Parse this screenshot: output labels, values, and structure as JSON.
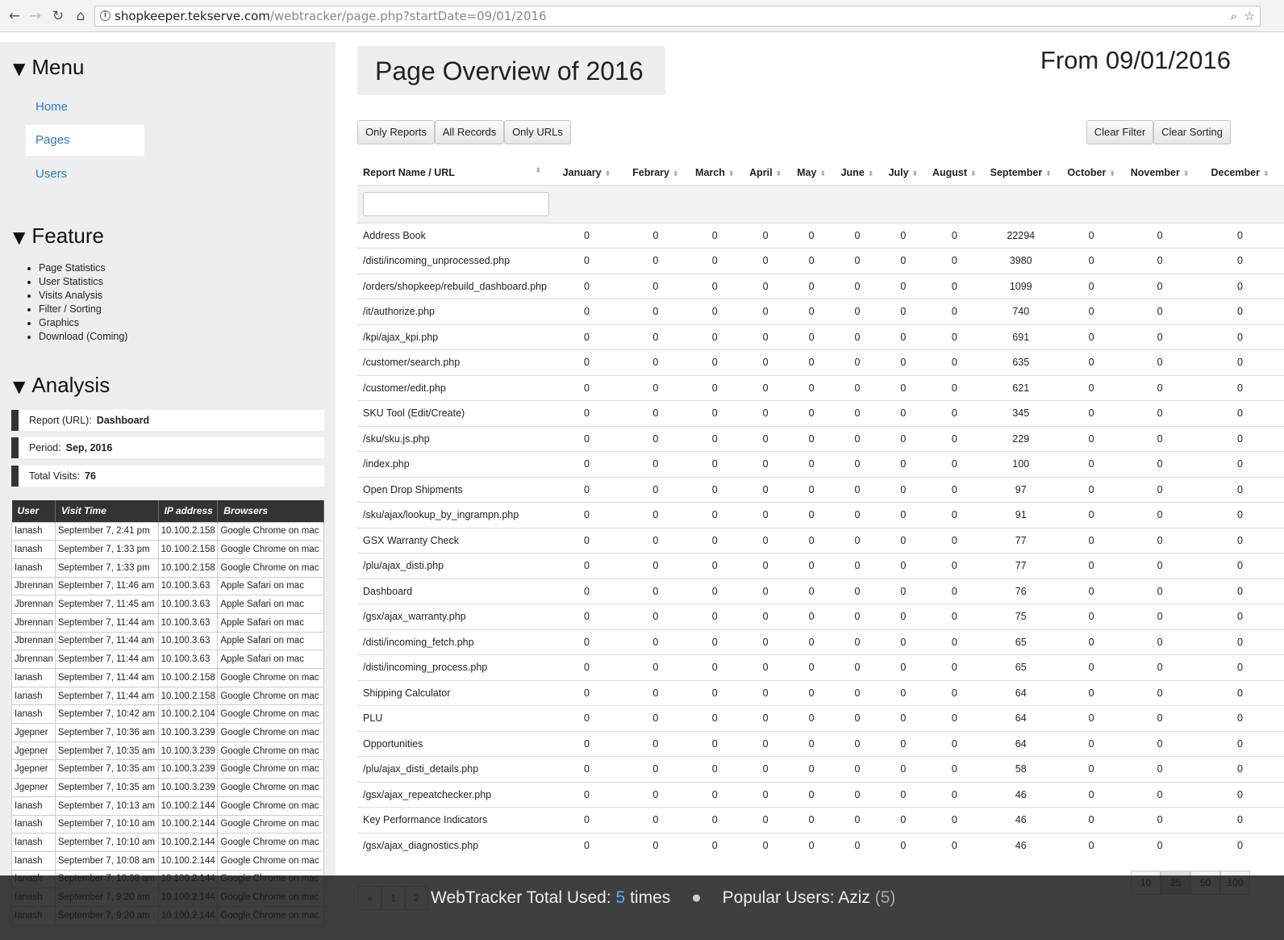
{
  "browser": {
    "url_host": "shopkeeper.tekserve.com",
    "url_path": "/webtracker/page.php?startDate=09/01/2016"
  },
  "sidebar": {
    "menu_heading": "Menu",
    "menu_items": [
      {
        "label": "Home"
      },
      {
        "label": "Pages",
        "active": true
      },
      {
        "label": "Users"
      }
    ],
    "feature_heading": "Feature",
    "features": [
      "Page Statistics",
      "User Statistics",
      "Visits Analysis",
      "Filter / Sorting",
      "Graphics",
      "Download (Coming)"
    ],
    "analysis_heading": "Analysis",
    "stats": [
      {
        "label": "Report (URL):",
        "value": "Dashboard"
      },
      {
        "label": "Period:",
        "value": "Sep, 2016"
      },
      {
        "label": "Total Visits:",
        "value": "76"
      }
    ],
    "visits_columns": [
      "User",
      "Visit Time",
      "IP address",
      "Browsers"
    ],
    "visits": [
      [
        "Ianash",
        "September 7, 2:41 pm",
        "10.100.2.158",
        "Google Chrome on mac"
      ],
      [
        "Ianash",
        "September 7, 1:33 pm",
        "10.100.2.158",
        "Google Chrome on mac"
      ],
      [
        "Ianash",
        "September 7, 1:33 pm",
        "10.100.2.158",
        "Google Chrome on mac"
      ],
      [
        "Jbrennan",
        "September 7, 11:46 am",
        "10.100.3.63",
        "Apple Safari on mac"
      ],
      [
        "Jbrennan",
        "September 7, 11:45 am",
        "10.100.3.63",
        "Apple Safari on mac"
      ],
      [
        "Jbrennan",
        "September 7, 11:44 am",
        "10.100.3.63",
        "Apple Safari on mac"
      ],
      [
        "Jbrennan",
        "September 7, 11:44 am",
        "10.100.3.63",
        "Apple Safari on mac"
      ],
      [
        "Jbrennan",
        "September 7, 11:44 am",
        "10.100.3.63",
        "Apple Safari on mac"
      ],
      [
        "Ianash",
        "September 7, 11:44 am",
        "10.100.2.158",
        "Google Chrome on mac"
      ],
      [
        "Ianash",
        "September 7, 11:44 am",
        "10.100.2.158",
        "Google Chrome on mac"
      ],
      [
        "Ianash",
        "September 7, 10:42 am",
        "10.100.2.104",
        "Google Chrome on mac"
      ],
      [
        "Jgepner",
        "September 7, 10:36 am",
        "10.100.3.239",
        "Google Chrome on mac"
      ],
      [
        "Jgepner",
        "September 7, 10:35 am",
        "10.100.3.239",
        "Google Chrome on mac"
      ],
      [
        "Jgepner",
        "September 7, 10:35 am",
        "10.100.3.239",
        "Google Chrome on mac"
      ],
      [
        "Jgepner",
        "September 7, 10:35 am",
        "10.100.3.239",
        "Google Chrome on mac"
      ],
      [
        "Ianash",
        "September 7, 10:13 am",
        "10.100.2.144",
        "Google Chrome on mac"
      ],
      [
        "Ianash",
        "September 7, 10:10 am",
        "10.100.2.144",
        "Google Chrome on mac"
      ],
      [
        "Ianash",
        "September 7, 10:10 am",
        "10.100.2.144",
        "Google Chrome on mac"
      ],
      [
        "Ianash",
        "September 7, 10:08 am",
        "10.100.2.144",
        "Google Chrome on mac"
      ],
      [
        "Ianash",
        "September 7, 10:08 am",
        "10.100.2.144",
        "Google Chrome on mac"
      ],
      [
        "Ianash",
        "September 7, 9:20 am",
        "10.100.2.144",
        "Google Chrome on mac"
      ],
      [
        "Ianash",
        "September 7, 9:20 am",
        "10.100.2.144",
        "Google Chrome on mac"
      ]
    ]
  },
  "main": {
    "title": "Page Overview of 2016",
    "from_date": "From 09/01/2016",
    "buttons": {
      "only_reports": "Only Reports",
      "all_records": "All Records",
      "only_urls": "Only URLs",
      "clear_filter": "Clear Filter",
      "clear_sorting": "Clear Sorting"
    },
    "columns": [
      "Report Name / URL",
      "January",
      "Febrary",
      "March",
      "April",
      "May",
      "June",
      "July",
      "August",
      "September",
      "October",
      "November",
      "December"
    ],
    "rows": [
      [
        "Address Book",
        "0",
        "0",
        "0",
        "0",
        "0",
        "0",
        "0",
        "0",
        "22294",
        "0",
        "0",
        "0"
      ],
      [
        "/disti/incoming_unprocessed.php",
        "0",
        "0",
        "0",
        "0",
        "0",
        "0",
        "0",
        "0",
        "3980",
        "0",
        "0",
        "0"
      ],
      [
        "/orders/shopkeep/rebuild_dashboard.php",
        "0",
        "0",
        "0",
        "0",
        "0",
        "0",
        "0",
        "0",
        "1099",
        "0",
        "0",
        "0"
      ],
      [
        "/it/authorize.php",
        "0",
        "0",
        "0",
        "0",
        "0",
        "0",
        "0",
        "0",
        "740",
        "0",
        "0",
        "0"
      ],
      [
        "/kpi/ajax_kpi.php",
        "0",
        "0",
        "0",
        "0",
        "0",
        "0",
        "0",
        "0",
        "691",
        "0",
        "0",
        "0"
      ],
      [
        "/customer/search.php",
        "0",
        "0",
        "0",
        "0",
        "0",
        "0",
        "0",
        "0",
        "635",
        "0",
        "0",
        "0"
      ],
      [
        "/customer/edit.php",
        "0",
        "0",
        "0",
        "0",
        "0",
        "0",
        "0",
        "0",
        "621",
        "0",
        "0",
        "0"
      ],
      [
        "SKU Tool (Edit/Create)",
        "0",
        "0",
        "0",
        "0",
        "0",
        "0",
        "0",
        "0",
        "345",
        "0",
        "0",
        "0"
      ],
      [
        "/sku/sku.js.php",
        "0",
        "0",
        "0",
        "0",
        "0",
        "0",
        "0",
        "0",
        "229",
        "0",
        "0",
        "0"
      ],
      [
        "/index.php",
        "0",
        "0",
        "0",
        "0",
        "0",
        "0",
        "0",
        "0",
        "100",
        "0",
        "0",
        "0"
      ],
      [
        "Open Drop Shipments",
        "0",
        "0",
        "0",
        "0",
        "0",
        "0",
        "0",
        "0",
        "97",
        "0",
        "0",
        "0"
      ],
      [
        "/sku/ajax/lookup_by_ingrampn.php",
        "0",
        "0",
        "0",
        "0",
        "0",
        "0",
        "0",
        "0",
        "91",
        "0",
        "0",
        "0"
      ],
      [
        "GSX Warranty Check",
        "0",
        "0",
        "0",
        "0",
        "0",
        "0",
        "0",
        "0",
        "77",
        "0",
        "0",
        "0"
      ],
      [
        "/plu/ajax_disti.php",
        "0",
        "0",
        "0",
        "0",
        "0",
        "0",
        "0",
        "0",
        "77",
        "0",
        "0",
        "0"
      ],
      [
        "Dashboard",
        "0",
        "0",
        "0",
        "0",
        "0",
        "0",
        "0",
        "0",
        "76",
        "0",
        "0",
        "0"
      ],
      [
        "/gsx/ajax_warranty.php",
        "0",
        "0",
        "0",
        "0",
        "0",
        "0",
        "0",
        "0",
        "75",
        "0",
        "0",
        "0"
      ],
      [
        "/disti/incoming_fetch.php",
        "0",
        "0",
        "0",
        "0",
        "0",
        "0",
        "0",
        "0",
        "65",
        "0",
        "0",
        "0"
      ],
      [
        "/disti/incoming_process.php",
        "0",
        "0",
        "0",
        "0",
        "0",
        "0",
        "0",
        "0",
        "65",
        "0",
        "0",
        "0"
      ],
      [
        "Shipping Calculator",
        "0",
        "0",
        "0",
        "0",
        "0",
        "0",
        "0",
        "0",
        "64",
        "0",
        "0",
        "0"
      ],
      [
        "PLU",
        "0",
        "0",
        "0",
        "0",
        "0",
        "0",
        "0",
        "0",
        "64",
        "0",
        "0",
        "0"
      ],
      [
        "Opportunities",
        "0",
        "0",
        "0",
        "0",
        "0",
        "0",
        "0",
        "0",
        "64",
        "0",
        "0",
        "0"
      ],
      [
        "/plu/ajax_disti_details.php",
        "0",
        "0",
        "0",
        "0",
        "0",
        "0",
        "0",
        "0",
        "58",
        "0",
        "0",
        "0"
      ],
      [
        "/gsx/ajax_repeatchecker.php",
        "0",
        "0",
        "0",
        "0",
        "0",
        "0",
        "0",
        "0",
        "46",
        "0",
        "0",
        "0"
      ],
      [
        "Key Performance Indicators",
        "0",
        "0",
        "0",
        "0",
        "0",
        "0",
        "0",
        "0",
        "46",
        "0",
        "0",
        "0"
      ],
      [
        "/gsx/ajax_diagnostics.php",
        "0",
        "0",
        "0",
        "0",
        "0",
        "0",
        "0",
        "0",
        "46",
        "0",
        "0",
        "0"
      ]
    ],
    "pager": [
      "«",
      "1",
      "2"
    ],
    "page_sizes": [
      "10",
      "25",
      "50",
      "100"
    ],
    "page_size_selected": "25"
  },
  "footer": {
    "used_label": "WebTracker Total Used:",
    "used_count": "5",
    "used_suffix": "times",
    "popular_label": "Popular Users: Aziz",
    "popular_count": "(5)"
  }
}
